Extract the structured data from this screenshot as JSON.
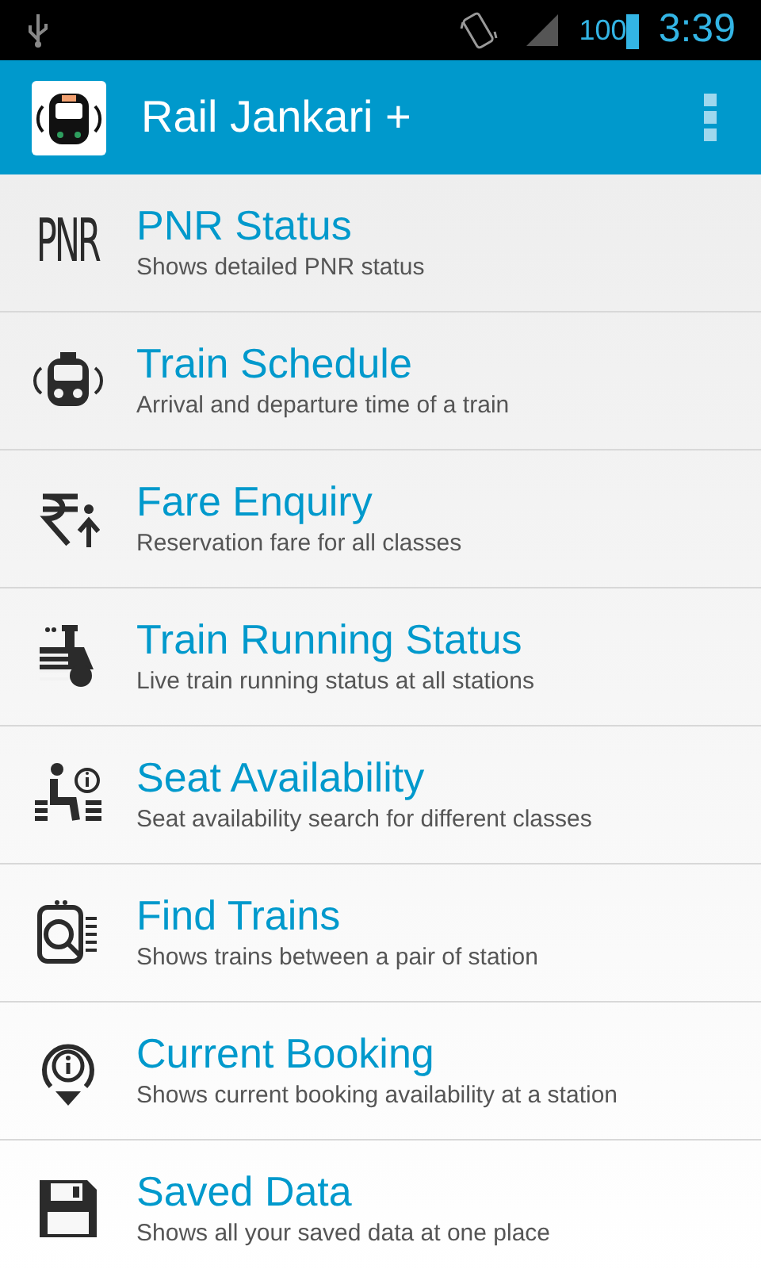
{
  "status_bar": {
    "battery": "100",
    "time": "3:39"
  },
  "app_bar": {
    "title": "Rail Jankari +"
  },
  "menu": [
    {
      "kind": "pnr",
      "icon_label": "PNR",
      "title": "PNR Status",
      "subtitle": "Shows detailed PNR status"
    },
    {
      "kind": "train",
      "title": "Train Schedule",
      "subtitle": "Arrival and departure time of a train"
    },
    {
      "kind": "fare",
      "title": "Fare Enquiry",
      "subtitle": "Reservation fare for all classes"
    },
    {
      "kind": "engine",
      "title": "Train Running Status",
      "subtitle": "Live train running status at all stations"
    },
    {
      "kind": "seat",
      "title": "Seat Availability",
      "subtitle": "Seat availability search for different classes"
    },
    {
      "kind": "find",
      "title": "Find Trains",
      "subtitle": "Shows trains between a pair of station"
    },
    {
      "kind": "booking",
      "title": "Current Booking",
      "subtitle": "Shows current booking availability at a station"
    },
    {
      "kind": "save",
      "title": "Saved Data",
      "subtitle": "Shows all your saved data at one place"
    }
  ]
}
